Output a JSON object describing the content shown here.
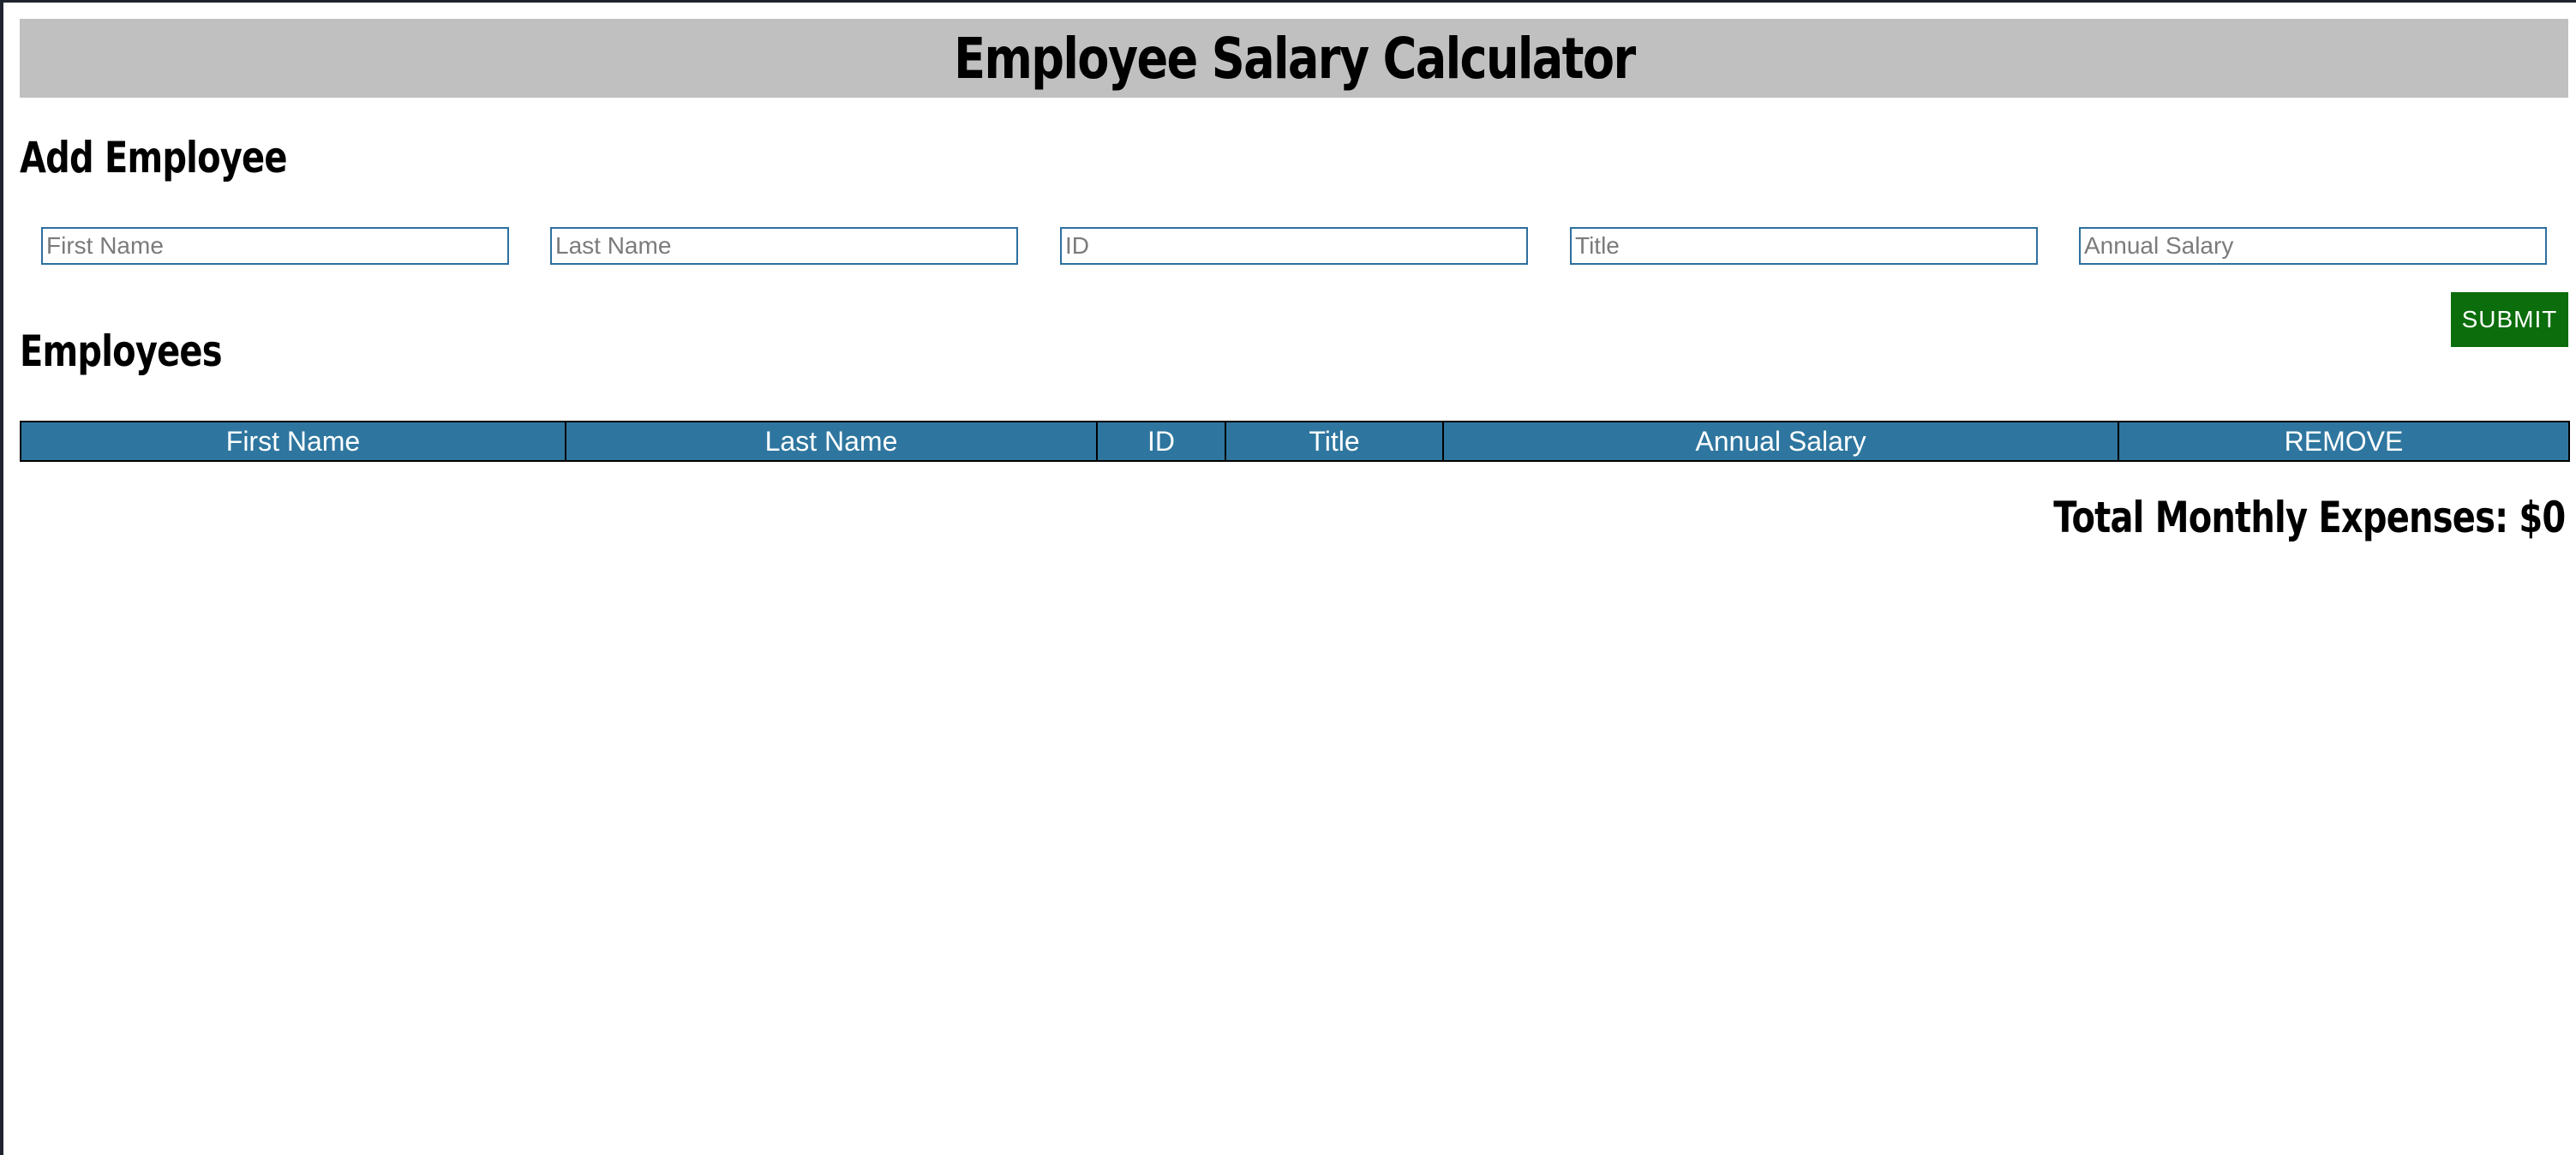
{
  "header": {
    "title": "Employee Salary Calculator"
  },
  "add_employee": {
    "heading": "Add Employee",
    "fields": [
      {
        "placeholder": "First Name",
        "value": ""
      },
      {
        "placeholder": "Last Name",
        "value": ""
      },
      {
        "placeholder": "ID",
        "value": ""
      },
      {
        "placeholder": "Title",
        "value": ""
      },
      {
        "placeholder": "Annual Salary",
        "value": ""
      }
    ],
    "submit_label": "SUBMIT"
  },
  "employees": {
    "heading": "Employees",
    "columns": [
      "First Name",
      "Last Name",
      "ID",
      "Title",
      "Annual Salary",
      "REMOVE"
    ],
    "rows": []
  },
  "totals": {
    "label": "Total Monthly Expenses: $0"
  },
  "colors": {
    "header_bg": "#c0c0c0",
    "table_header_bg": "#2e769f",
    "submit_bg": "#0b6d0b",
    "input_border": "#2c6f9e"
  }
}
